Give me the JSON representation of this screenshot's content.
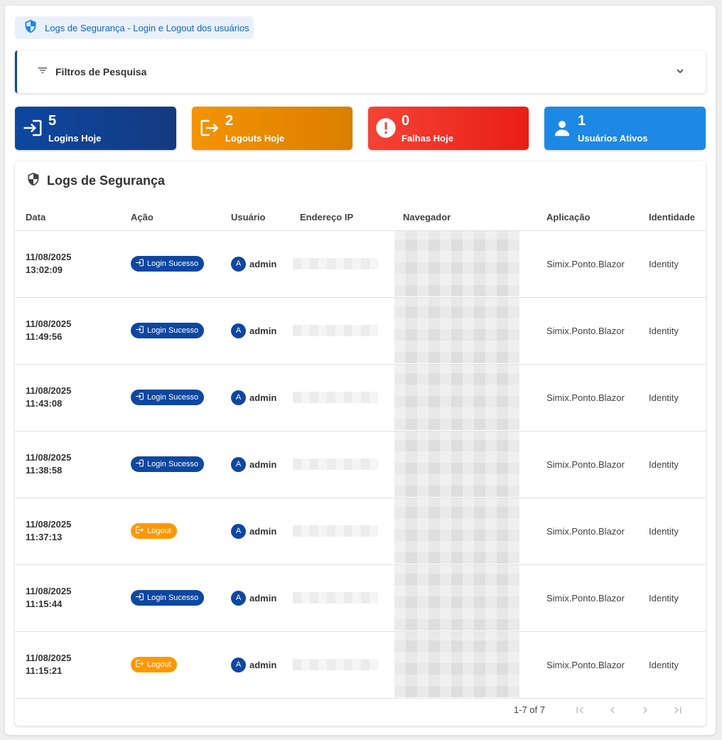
{
  "header": {
    "title": "Logs de Segurança - Login e Logout dos usuários",
    "icon": "shield-icon"
  },
  "filters": {
    "label": "Filtros de Pesquisa"
  },
  "stats": {
    "logins": {
      "value": "5",
      "label": "Logins Hoje",
      "color": "#0d47a1"
    },
    "logouts": {
      "value": "2",
      "label": "Logouts Hoje",
      "color": "#f59400"
    },
    "failures": {
      "value": "0",
      "label": "Falhas Hoje",
      "color": "#f44336"
    },
    "active_users": {
      "value": "1",
      "label": "Usuários Ativos",
      "color": "#1e88e5"
    }
  },
  "logs": {
    "title": "Logs de Segurança",
    "columns": [
      "Data",
      "Ação",
      "Usuário",
      "Endereço IP",
      "Navegador",
      "Aplicação",
      "Identidade"
    ],
    "rows": [
      {
        "date": "11/08/2025",
        "time": "13:02:09",
        "action": "Login Sucesso",
        "type": "login",
        "avatar": "A",
        "user": "admin",
        "application": "Simix.Ponto.Blazor",
        "identity": "Identity"
      },
      {
        "date": "11/08/2025",
        "time": "11:49:56",
        "action": "Login Sucesso",
        "type": "login",
        "avatar": "A",
        "user": "admin",
        "application": "Simix.Ponto.Blazor",
        "identity": "Identity"
      },
      {
        "date": "11/08/2025",
        "time": "11:43:08",
        "action": "Login Sucesso",
        "type": "login",
        "avatar": "A",
        "user": "admin",
        "application": "Simix.Ponto.Blazor",
        "identity": "Identity"
      },
      {
        "date": "11/08/2025",
        "time": "11:38:58",
        "action": "Login Sucesso",
        "type": "login",
        "avatar": "A",
        "user": "admin",
        "application": "Simix.Ponto.Blazor",
        "identity": "Identity"
      },
      {
        "date": "11/08/2025",
        "time": "11:37:13",
        "action": "Logout",
        "type": "logout",
        "avatar": "A",
        "user": "admin",
        "application": "Simix.Ponto.Blazor",
        "identity": "Identity"
      },
      {
        "date": "11/08/2025",
        "time": "11:15:44",
        "action": "Login Sucesso",
        "type": "login",
        "avatar": "A",
        "user": "admin",
        "application": "Simix.Ponto.Blazor",
        "identity": "Identity"
      },
      {
        "date": "11/08/2025",
        "time": "11:15:21",
        "action": "Logout",
        "type": "logout",
        "avatar": "A",
        "user": "admin",
        "application": "Simix.Ponto.Blazor",
        "identity": "Identity"
      }
    ]
  },
  "pagination": {
    "info": "1-7 of 7"
  }
}
